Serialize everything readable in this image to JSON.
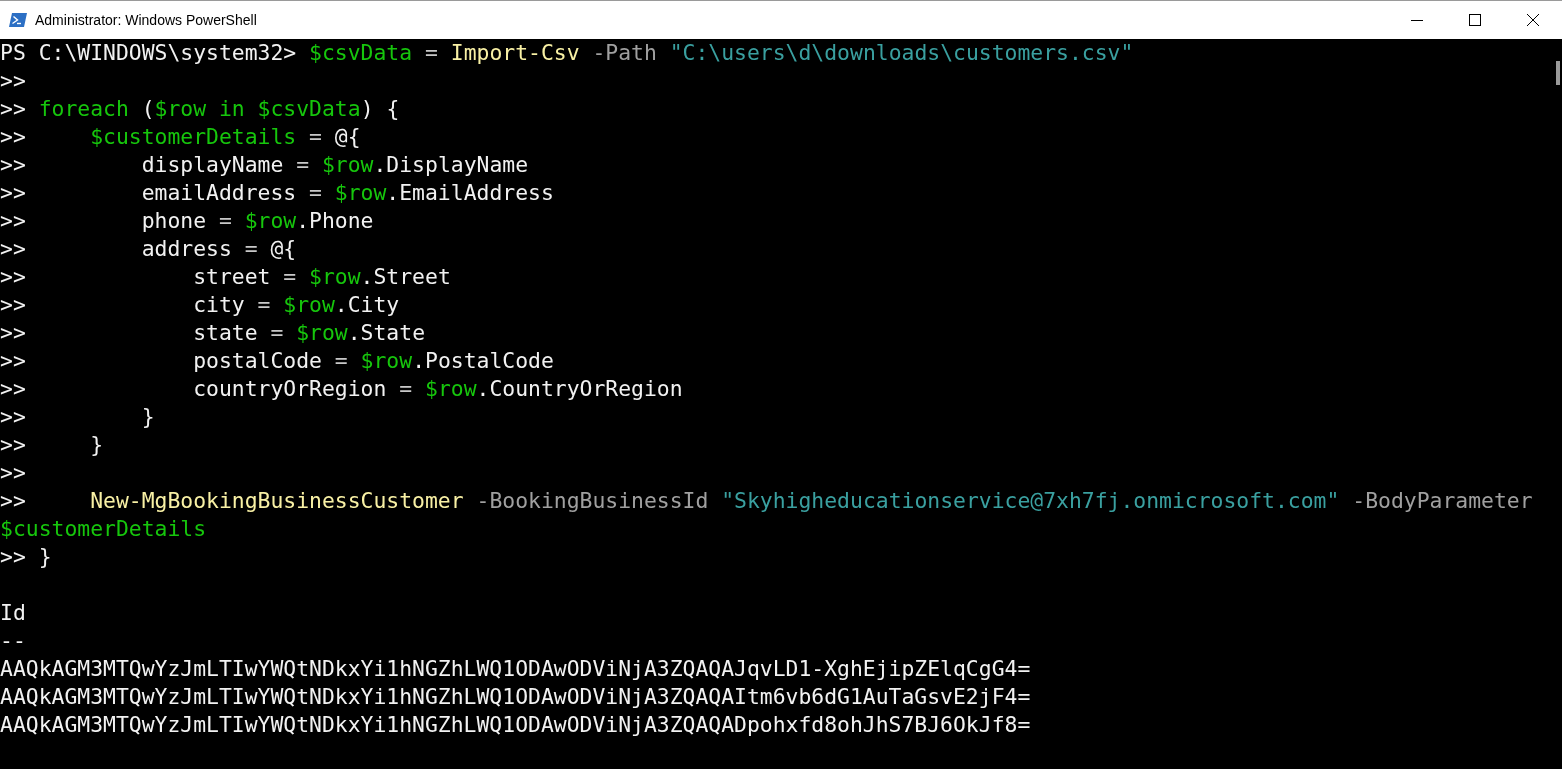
{
  "window": {
    "title": "Administrator: Windows PowerShell"
  },
  "console": {
    "lines": [
      [
        {
          "text": "PS C:\\WINDOWS\\system32> ",
          "kind": "plain"
        },
        {
          "text": "$csvData",
          "kind": "variable"
        },
        {
          "text": " = ",
          "kind": "operator"
        },
        {
          "text": "Import-Csv",
          "kind": "command"
        },
        {
          "text": " -Path ",
          "kind": "parameter"
        },
        {
          "text": "\"C:\\users\\d\\downloads\\customers.csv\"",
          "kind": "string"
        }
      ],
      [
        {
          "text": ">>",
          "kind": "plain"
        }
      ],
      [
        {
          "text": ">> ",
          "kind": "plain"
        },
        {
          "text": "foreach",
          "kind": "variable"
        },
        {
          "text": " (",
          "kind": "plain"
        },
        {
          "text": "$row",
          "kind": "variable"
        },
        {
          "text": " in ",
          "kind": "variable"
        },
        {
          "text": "$csvData",
          "kind": "variable"
        },
        {
          "text": ") {",
          "kind": "plain"
        }
      ],
      [
        {
          "text": ">>     ",
          "kind": "plain"
        },
        {
          "text": "$customerDetails",
          "kind": "variable"
        },
        {
          "text": " = ",
          "kind": "operator"
        },
        {
          "text": "@{",
          "kind": "plain"
        }
      ],
      [
        {
          "text": ">>         displayName ",
          "kind": "plain"
        },
        {
          "text": "= ",
          "kind": "operator"
        },
        {
          "text": "$row",
          "kind": "variable"
        },
        {
          "text": ".DisplayName",
          "kind": "plain"
        }
      ],
      [
        {
          "text": ">>         emailAddress ",
          "kind": "plain"
        },
        {
          "text": "= ",
          "kind": "operator"
        },
        {
          "text": "$row",
          "kind": "variable"
        },
        {
          "text": ".EmailAddress",
          "kind": "plain"
        }
      ],
      [
        {
          "text": ">>         phone ",
          "kind": "plain"
        },
        {
          "text": "= ",
          "kind": "operator"
        },
        {
          "text": "$row",
          "kind": "variable"
        },
        {
          "text": ".Phone",
          "kind": "plain"
        }
      ],
      [
        {
          "text": ">>         address ",
          "kind": "plain"
        },
        {
          "text": "= ",
          "kind": "operator"
        },
        {
          "text": "@{",
          "kind": "plain"
        }
      ],
      [
        {
          "text": ">>             street ",
          "kind": "plain"
        },
        {
          "text": "= ",
          "kind": "operator"
        },
        {
          "text": "$row",
          "kind": "variable"
        },
        {
          "text": ".Street",
          "kind": "plain"
        }
      ],
      [
        {
          "text": ">>             city ",
          "kind": "plain"
        },
        {
          "text": "= ",
          "kind": "operator"
        },
        {
          "text": "$row",
          "kind": "variable"
        },
        {
          "text": ".City",
          "kind": "plain"
        }
      ],
      [
        {
          "text": ">>             state ",
          "kind": "plain"
        },
        {
          "text": "= ",
          "kind": "operator"
        },
        {
          "text": "$row",
          "kind": "variable"
        },
        {
          "text": ".State",
          "kind": "plain"
        }
      ],
      [
        {
          "text": ">>             postalCode ",
          "kind": "plain"
        },
        {
          "text": "= ",
          "kind": "operator"
        },
        {
          "text": "$row",
          "kind": "variable"
        },
        {
          "text": ".PostalCode",
          "kind": "plain"
        }
      ],
      [
        {
          "text": ">>             countryOrRegion ",
          "kind": "plain"
        },
        {
          "text": "= ",
          "kind": "operator"
        },
        {
          "text": "$row",
          "kind": "variable"
        },
        {
          "text": ".CountryOrRegion",
          "kind": "plain"
        }
      ],
      [
        {
          "text": ">>         }",
          "kind": "plain"
        }
      ],
      [
        {
          "text": ">>     }",
          "kind": "plain"
        }
      ],
      [
        {
          "text": ">>",
          "kind": "plain"
        }
      ],
      [
        {
          "text": ">>     ",
          "kind": "plain"
        },
        {
          "text": "New-MgBookingBusinessCustomer",
          "kind": "command"
        },
        {
          "text": " -BookingBusinessId ",
          "kind": "parameter"
        },
        {
          "text": "\"Skyhigheducationservice@7xh7fj.onmicrosoft.com\"",
          "kind": "string"
        },
        {
          "text": " -BodyParameter",
          "kind": "parameter"
        }
      ],
      [
        {
          "text": "$customerDetails",
          "kind": "variable"
        }
      ],
      [
        {
          "text": ">> }",
          "kind": "plain"
        }
      ]
    ],
    "output": {
      "heading": "Id",
      "rule": "--",
      "rows": [
        "AAQkAGM3MTQwYzJmLTIwYWQtNDkxYi1hNGZhLWQ1ODAwODViNjA3ZQAQAJqvLD1-XghEjipZElqCgG4=",
        "AAQkAGM3MTQwYzJmLTIwYWQtNDkxYi1hNGZhLWQ1ODAwODViNjA3ZQAQAItm6vb6dG1AuTaGsvE2jF4=",
        "AAQkAGM3MTQwYzJmLTIwYWQtNDkxYi1hNGZhLWQ1ODAwODViNjA3ZQAQADpohxfd8ohJhS7BJ6OkJf8="
      ]
    }
  }
}
